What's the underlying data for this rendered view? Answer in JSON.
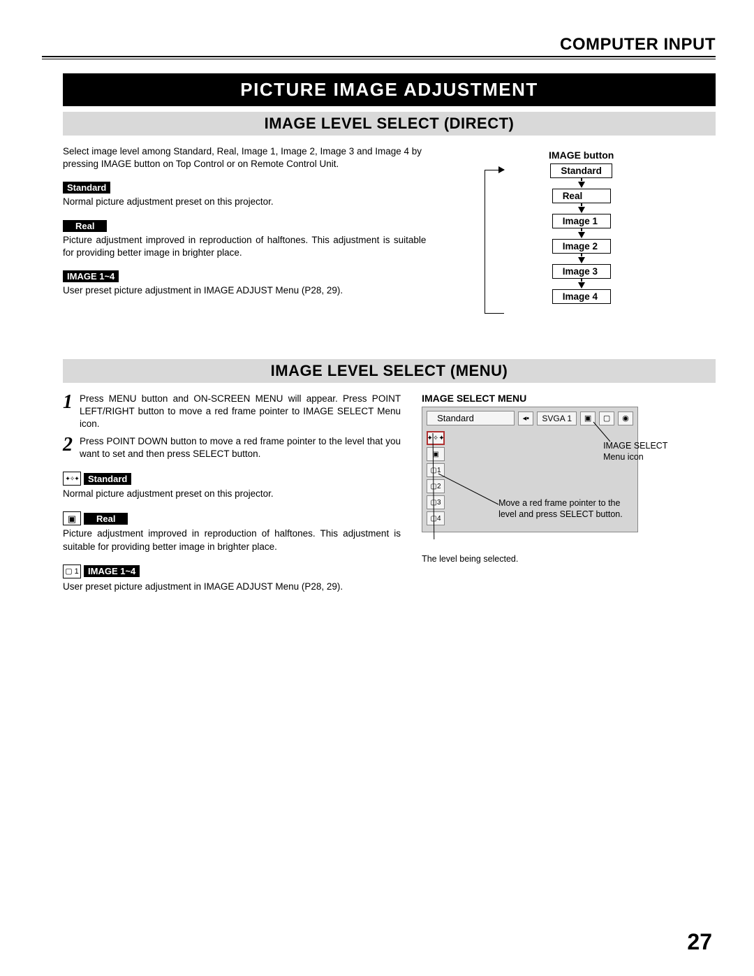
{
  "header": {
    "section": "COMPUTER INPUT"
  },
  "title": "PICTURE IMAGE ADJUSTMENT",
  "direct": {
    "heading": "IMAGE LEVEL SELECT (DIRECT)",
    "intro": "Select image level among Standard, Real, Image 1, Image 2, Image 3 and Image 4 by pressing IMAGE button on Top Control or on Remote Control Unit.",
    "items": [
      {
        "tag": "Standard",
        "desc": "Normal picture adjustment preset on this projector."
      },
      {
        "tag": "Real",
        "desc": "Picture adjustment improved in reproduction of halftones.  This adjustment is suitable for providing better image in brighter place."
      },
      {
        "tag": "IMAGE 1~4",
        "desc": "User preset picture adjustment in IMAGE ADJUST Menu (P28, 29)."
      }
    ],
    "diagram": {
      "title": "IMAGE button",
      "states": [
        "Standard",
        "Real",
        "Image 1",
        "Image 2",
        "Image 3",
        "Image 4"
      ]
    }
  },
  "menu": {
    "heading": "IMAGE LEVEL SELECT (MENU)",
    "steps": [
      "Press MENU button and ON-SCREEN MENU will appear.  Press POINT LEFT/RIGHT button to move a red frame pointer to IMAGE SELECT Menu icon.",
      "Press POINT DOWN button to move a red frame pointer to the level that you want to set and then press SELECT button."
    ],
    "items": [
      {
        "tag": "Standard",
        "desc": "Normal picture adjustment preset on this projector.",
        "icon": "diamonds"
      },
      {
        "tag": "Real",
        "desc": "Picture adjustment improved in reproduction of halftones.  This adjustment is suitable for providing better image in brighter place.",
        "icon": "monitor"
      },
      {
        "tag": "IMAGE 1~4",
        "desc": "User preset picture adjustment in IMAGE ADJUST Menu (P28, 29).",
        "icon": "sq1"
      }
    ],
    "osd": {
      "caption": "IMAGE SELECT MENU",
      "label": "Standard",
      "resolution": "SVGA 1",
      "side_items": [
        "✦",
        "▢",
        "▢1",
        "▢2",
        "▢3",
        "▢4"
      ],
      "annot_icon": "IMAGE SELECT Menu icon",
      "annot_pointer": "Move a red frame pointer to the level and press SELECT button.",
      "annot_selected": "The level being selected."
    }
  },
  "page_number": "27"
}
